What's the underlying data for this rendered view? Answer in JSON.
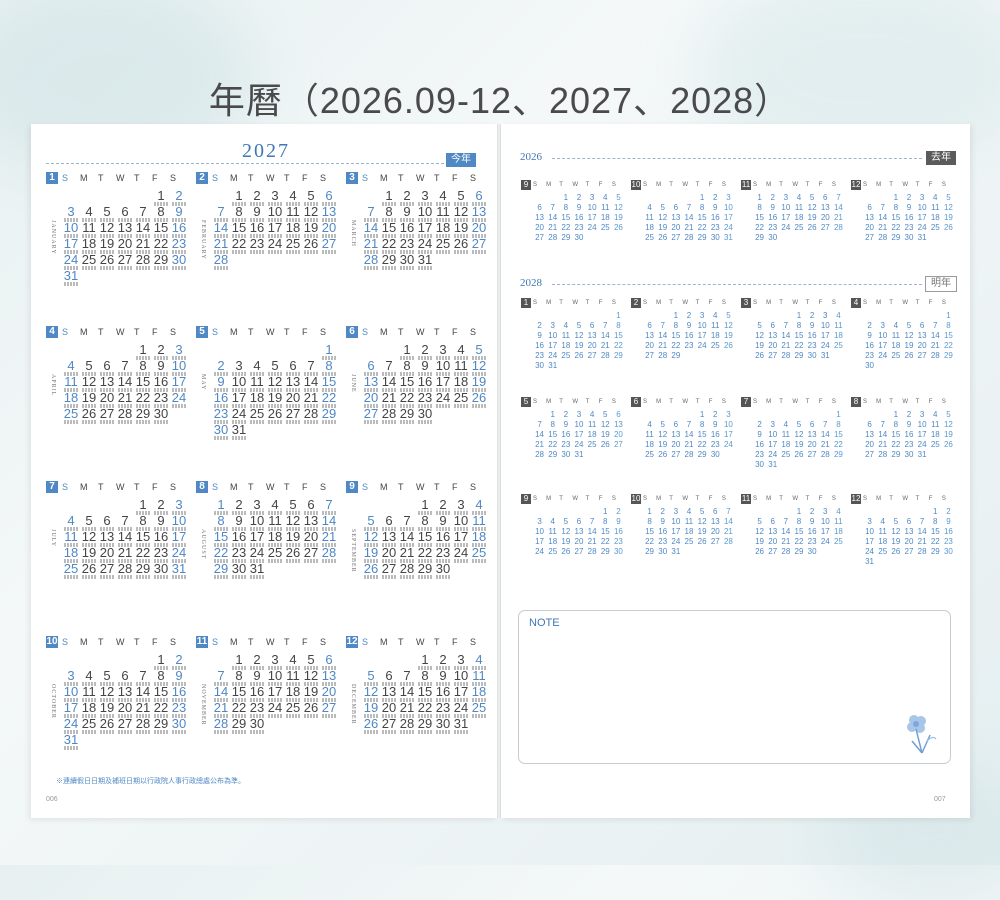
{
  "title": "年曆（2026.09-12、2027、2028）",
  "left_page": {
    "year": "2027",
    "tag": "今年",
    "weekdays": [
      "S",
      "M",
      "T",
      "W",
      "T",
      "F",
      "S"
    ],
    "months": [
      {
        "num": "1",
        "name": "JANUARY",
        "start": 5,
        "days": 31
      },
      {
        "num": "2",
        "name": "FEBRUARY",
        "start": 1,
        "days": 28
      },
      {
        "num": "3",
        "name": "MARCH",
        "start": 1,
        "days": 31
      },
      {
        "num": "4",
        "name": "APRIL",
        "start": 4,
        "days": 30
      },
      {
        "num": "5",
        "name": "MAY",
        "start": 6,
        "days": 31
      },
      {
        "num": "6",
        "name": "JUNE",
        "start": 2,
        "days": 30
      },
      {
        "num": "7",
        "name": "JULY",
        "start": 4,
        "days": 31
      },
      {
        "num": "8",
        "name": "AUGUST",
        "start": 0,
        "days": 31
      },
      {
        "num": "9",
        "name": "SEPTEMBER",
        "start": 3,
        "days": 30
      },
      {
        "num": "10",
        "name": "OCTOBER",
        "start": 5,
        "days": 31
      },
      {
        "num": "11",
        "name": "NOVEMBER",
        "start": 1,
        "days": 30
      },
      {
        "num": "12",
        "name": "DECEMBER",
        "start": 3,
        "days": 31
      }
    ],
    "footnote": "※連續假日日期及補班日期以行政院人事行政總處公布為準。",
    "page_number": "006"
  },
  "right_page": {
    "weekdays": [
      "S",
      "M",
      "T",
      "W",
      "T",
      "F",
      "S"
    ],
    "year_prev": {
      "label": "2026",
      "tag": "去年",
      "months": [
        {
          "num": "9",
          "start": 2,
          "days": 30
        },
        {
          "num": "10",
          "start": 4,
          "days": 31
        },
        {
          "num": "11",
          "start": 0,
          "days": 30
        },
        {
          "num": "12",
          "start": 2,
          "days": 31
        }
      ]
    },
    "year_next": {
      "label": "2028",
      "tag": "明年",
      "months": [
        {
          "num": "1",
          "start": 6,
          "days": 31
        },
        {
          "num": "2",
          "start": 2,
          "days": 29
        },
        {
          "num": "3",
          "start": 3,
          "days": 31
        },
        {
          "num": "4",
          "start": 6,
          "days": 30
        },
        {
          "num": "5",
          "start": 1,
          "days": 31
        },
        {
          "num": "6",
          "start": 4,
          "days": 30
        },
        {
          "num": "7",
          "start": 6,
          "days": 31
        },
        {
          "num": "8",
          "start": 2,
          "days": 31
        },
        {
          "num": "9",
          "start": 5,
          "days": 30
        },
        {
          "num": "10",
          "start": 0,
          "days": 31
        },
        {
          "num": "11",
          "start": 3,
          "days": 30
        },
        {
          "num": "12",
          "start": 5,
          "days": 31
        }
      ]
    },
    "note_label": "NOTE",
    "page_number": "007"
  },
  "colors": {
    "accent": "#4f88c4",
    "title": "#3f78b5",
    "dark_tag": "#5b5b5b"
  }
}
